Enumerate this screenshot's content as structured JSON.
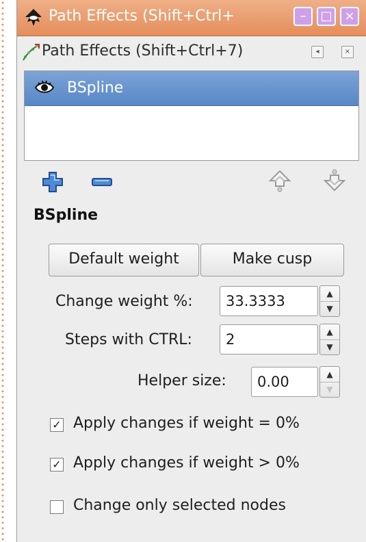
{
  "window": {
    "title": "Path Effects  (Shift+Ctrl+",
    "minimize_glyph": "–",
    "maximize_glyph": "□",
    "close_glyph": "×"
  },
  "dialog": {
    "title": "Path Effects  (Shift+Ctrl+7)",
    "panel_btn_glyph": "◂",
    "close_btn_glyph": "×"
  },
  "effects_list": {
    "items": [
      {
        "label": "BSpline",
        "visible_icon": "eye-icon",
        "selected": true
      }
    ]
  },
  "toolbar": {
    "add_icon": "plus-icon",
    "remove_icon": "minus-icon",
    "raise_icon": "raise-arrow-icon",
    "lower_icon": "lower-arrow-icon"
  },
  "effect_settings": {
    "title": "BSpline",
    "default_weight_label": "Default weight",
    "make_cusp_label": "Make cusp",
    "change_weight_label": "Change weight %:",
    "change_weight_value": "33.3333",
    "steps_label": "Steps with CTRL:",
    "steps_value": "2",
    "helper_size_label": "Helper size:",
    "helper_size_value": "0.00",
    "apply_zero_label": "Apply changes if weight = 0%",
    "apply_zero_checked": true,
    "apply_nonzero_label": "Apply changes if weight > 0%",
    "apply_nonzero_checked": true,
    "only_selected_label": "Change only selected nodes",
    "only_selected_checked": false
  },
  "colors": {
    "titlebar": "#e48e5c",
    "selection": "#5887c7",
    "accent_blue": "#3b75c2"
  }
}
